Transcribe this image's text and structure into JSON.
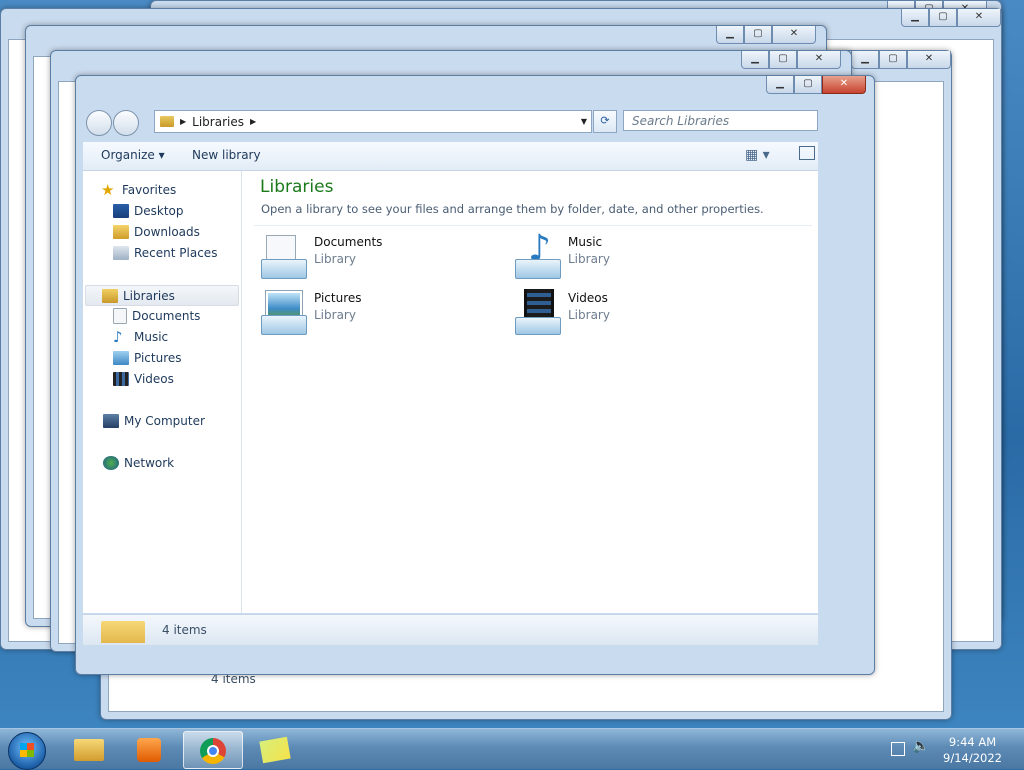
{
  "window": {
    "address": {
      "location": "Libraries"
    },
    "search": {
      "placeholder": "Search Libraries"
    },
    "toolbar": {
      "organize_label": "Organize",
      "new_library_label": "New library"
    }
  },
  "nav": {
    "favorites_label": "Favorites",
    "favorites": [
      "Desktop",
      "Downloads",
      "Recent Places"
    ],
    "libraries_label": "Libraries",
    "libraries": [
      "Documents",
      "Music",
      "Pictures",
      "Videos"
    ],
    "computer_label": "My Computer",
    "network_label": "Network"
  },
  "content": {
    "title": "Libraries",
    "subtitle": "Open a library to see your files and arrange them by folder, date, and other properties.",
    "items": [
      {
        "name": "Documents",
        "type": "Library",
        "icon": "documents-library-icon"
      },
      {
        "name": "Music",
        "type": "Library",
        "icon": "music-library-icon"
      },
      {
        "name": "Pictures",
        "type": "Library",
        "icon": "pictures-library-icon"
      },
      {
        "name": "Videos",
        "type": "Library",
        "icon": "videos-library-icon"
      }
    ]
  },
  "status": {
    "count_text": "4 items"
  },
  "background_windows": {
    "status_text": "4 items"
  },
  "taskbar": {
    "apps": [
      "windows-explorer-icon",
      "media-player-icon",
      "chrome-icon",
      "sticky-notes-icon"
    ],
    "clock": {
      "time": "9:44 AM",
      "date": "9/14/2022"
    }
  },
  "colors": {
    "title_green": "#1a7a1a",
    "close_red": "#c74430",
    "taskbar": "#5d8bb5"
  }
}
